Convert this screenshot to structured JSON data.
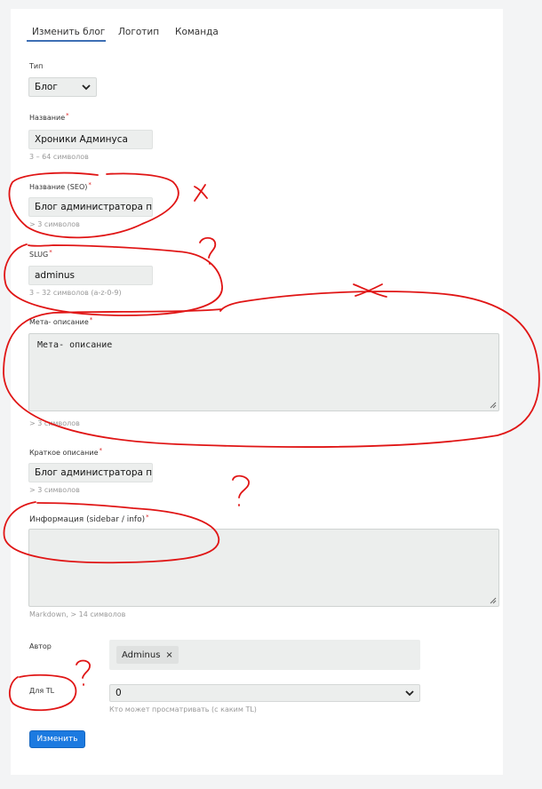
{
  "tabs": [
    {
      "label": "Изменить блог",
      "active": true
    },
    {
      "label": "Логотип",
      "active": false
    },
    {
      "label": "Команда",
      "active": false
    }
  ],
  "form": {
    "type": {
      "label": "Тип",
      "value": "Блог"
    },
    "name": {
      "label": "Название",
      "required_mark": "*",
      "value": "Хроники Админуса",
      "hint": "3 – 64 символов"
    },
    "seo_name": {
      "label": "Название (SEO)",
      "required_mark": "*",
      "value": "Блог администратора проекта",
      "hint": "> 3 символов"
    },
    "slug": {
      "label": "SLUG",
      "required_mark": "*",
      "value": "adminus",
      "hint": "3 – 32 символов (a-z-0-9)"
    },
    "meta": {
      "label": "Мета- описание",
      "required_mark": "*",
      "value": "Мета- описание",
      "hint": "> 3 символов"
    },
    "short_desc": {
      "label": "Краткое описание",
      "required_mark": "*",
      "value": "Блог администратора проекта",
      "hint": "> 3 символов"
    },
    "info": {
      "label": "Информация (sidebar / info)",
      "required_mark": "*",
      "value": "",
      "hint": "Markdown, > 14 символов"
    },
    "author": {
      "label": "Автор",
      "chip": "Adminus",
      "chip_remove": "×"
    },
    "tl": {
      "label": "Для TL",
      "value": "0",
      "hint": "Кто может просматривать (с каким TL)"
    },
    "submit_label": "Изменить"
  },
  "annotations": {
    "color": "#e01515",
    "marks": [
      "x",
      "?",
      "x",
      "?",
      "?"
    ]
  }
}
